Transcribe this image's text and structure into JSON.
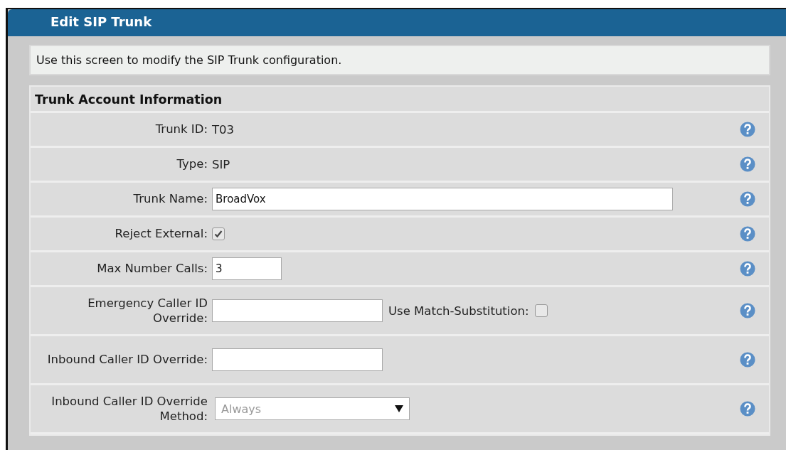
{
  "panel": {
    "title": "Edit SIP Trunk"
  },
  "intro": "Use this screen to modify the SIP Trunk configuration.",
  "section": {
    "title": "Trunk Account Information",
    "rows": [
      {
        "label": "Trunk ID:",
        "kind": "text",
        "value": "T03"
      },
      {
        "label": "Type:",
        "kind": "text",
        "value": "SIP"
      },
      {
        "label": "Trunk Name:",
        "kind": "longfield",
        "value": "BroadVox"
      },
      {
        "label": "Reject External:",
        "kind": "checkbox",
        "checked": true
      },
      {
        "label": "Max Number Calls:",
        "kind": "shortfield",
        "value": "3"
      },
      {
        "label": "Emergency Caller ID Override:",
        "kind": "field",
        "extra": {
          "label": "Use Match-Substitution:",
          "checked": false
        }
      },
      {
        "label": "Inbound Caller ID Override:",
        "kind": "field"
      },
      {
        "label": "Inbound Caller ID Override Method:",
        "kind": "select",
        "value": "Always",
        "disabled": true
      }
    ]
  }
}
